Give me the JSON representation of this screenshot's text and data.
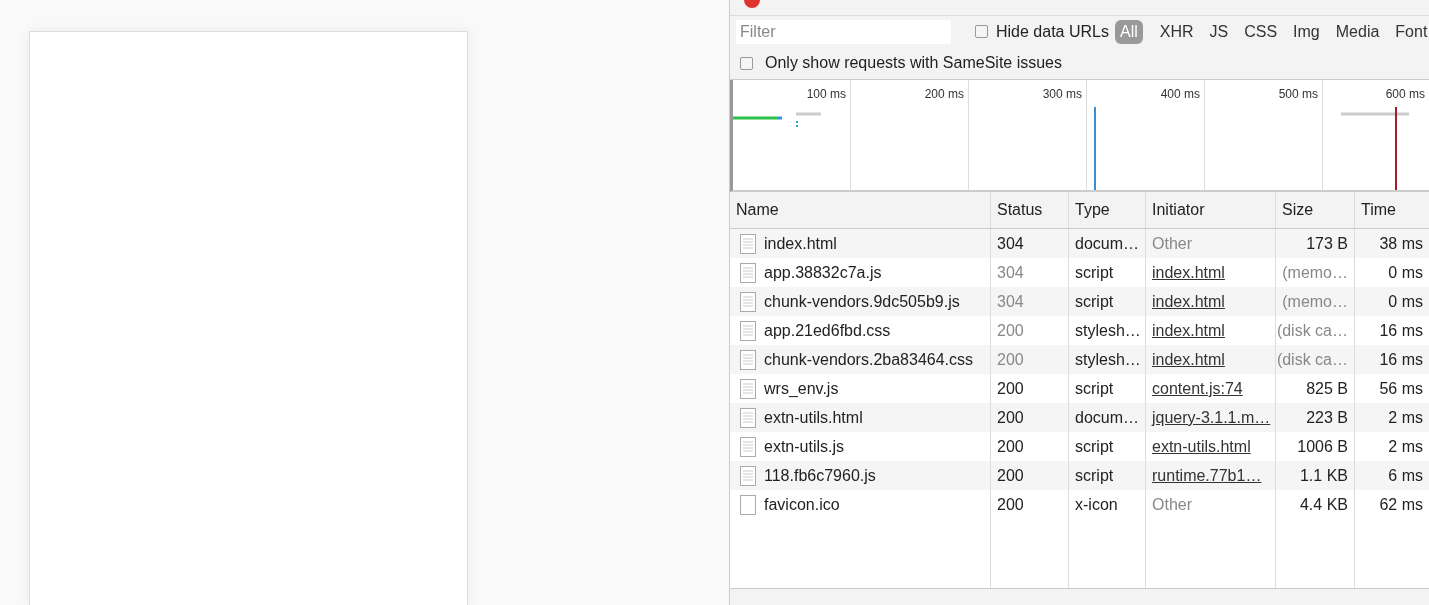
{
  "filter_bar": {
    "filter": {
      "placeholder": "Filter"
    },
    "hide_data_urls": {
      "label": "Hide data URLs",
      "checked": false
    },
    "type_filters": [
      {
        "label": "All",
        "selected": true
      },
      {
        "label": "XHR",
        "selected": false
      },
      {
        "label": "JS",
        "selected": false
      },
      {
        "label": "CSS",
        "selected": false
      },
      {
        "label": "Img",
        "selected": false
      },
      {
        "label": "Media",
        "selected": false
      },
      {
        "label": "Font",
        "selected": false
      }
    ],
    "samesite_only": {
      "label": "Only show requests with SameSite issues",
      "checked": false
    }
  },
  "overview": {
    "ticks": [
      "100 ms",
      "200 ms",
      "300 ms",
      "400 ms",
      "500 ms",
      "600 ms"
    ]
  },
  "table": {
    "columns": [
      "Name",
      "Status",
      "Type",
      "Initiator",
      "Size",
      "Time"
    ],
    "rows": [
      {
        "name": "index.html",
        "kind": "document",
        "status": "304",
        "status_muted": false,
        "type": "docum…",
        "initiator": "Other",
        "initiator_link": false,
        "size": "173 B",
        "size_muted": false,
        "time": "38 ms"
      },
      {
        "name": "app.38832c7a.js",
        "kind": "document",
        "status": "304",
        "status_muted": true,
        "type": "script",
        "initiator": "index.html",
        "initiator_link": true,
        "size": "(memo…",
        "size_muted": true,
        "time": "0 ms"
      },
      {
        "name": "chunk-vendors.9dc505b9.js",
        "kind": "document",
        "status": "304",
        "status_muted": true,
        "type": "script",
        "initiator": "index.html",
        "initiator_link": true,
        "size": "(memo…",
        "size_muted": true,
        "time": "0 ms"
      },
      {
        "name": "app.21ed6fbd.css",
        "kind": "document",
        "status": "200",
        "status_muted": true,
        "type": "stylesh…",
        "initiator": "index.html",
        "initiator_link": true,
        "size": "(disk ca…",
        "size_muted": true,
        "time": "16 ms"
      },
      {
        "name": "chunk-vendors.2ba83464.css",
        "kind": "document",
        "status": "200",
        "status_muted": true,
        "type": "stylesh…",
        "initiator": "index.html",
        "initiator_link": true,
        "size": "(disk ca…",
        "size_muted": true,
        "time": "16 ms"
      },
      {
        "name": "wrs_env.js",
        "kind": "document",
        "status": "200",
        "status_muted": false,
        "type": "script",
        "initiator": "content.js:74",
        "initiator_link": true,
        "size": "825 B",
        "size_muted": false,
        "time": "56 ms"
      },
      {
        "name": "extn-utils.html",
        "kind": "document",
        "status": "200",
        "status_muted": false,
        "type": "docum…",
        "initiator": "jquery-3.1.1.m…",
        "initiator_link": true,
        "size": "223 B",
        "size_muted": false,
        "time": "2 ms"
      },
      {
        "name": "extn-utils.js",
        "kind": "document",
        "status": "200",
        "status_muted": false,
        "type": "script",
        "initiator": "extn-utils.html",
        "initiator_link": true,
        "size": "1006 B",
        "size_muted": false,
        "time": "2 ms"
      },
      {
        "name": "118.fb6c7960.js",
        "kind": "document",
        "status": "200",
        "status_muted": false,
        "type": "script",
        "initiator": "runtime.77b1…",
        "initiator_link": true,
        "size": "1.1 KB",
        "size_muted": false,
        "time": "6 ms"
      },
      {
        "name": "favicon.ico",
        "kind": "blank",
        "status": "200",
        "status_muted": false,
        "type": "x-icon",
        "initiator": "Other",
        "initiator_link": false,
        "size": "4.4 KB",
        "size_muted": false,
        "time": "62 ms"
      }
    ]
  }
}
